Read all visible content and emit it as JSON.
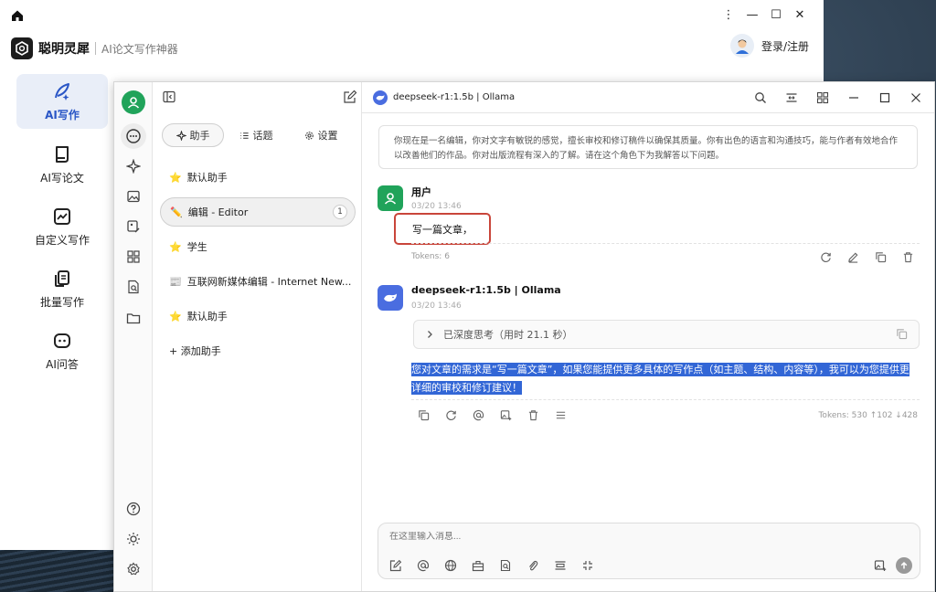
{
  "app": {
    "brand": "聪明灵犀",
    "subtitle": "AI论文写作神器",
    "login_label": "登录/注册",
    "window_controls": [
      "⋮",
      "—",
      "☐",
      "✕"
    ]
  },
  "outer_nav": [
    {
      "label": "AI写作",
      "icon": "feather-pen-icon",
      "active": true
    },
    {
      "label": "AI写论文",
      "icon": "paper-scroll-icon",
      "active": false
    },
    {
      "label": "自定义写作",
      "icon": "chart-box-icon",
      "active": false
    },
    {
      "label": "批量写作",
      "icon": "copy-docs-icon",
      "active": false
    },
    {
      "label": "AI问答",
      "icon": "robot-chat-icon",
      "active": false
    }
  ],
  "assistant_panel": {
    "tabs": [
      {
        "label": "助手",
        "icon": "sparkle-icon",
        "active": true
      },
      {
        "label": "话题",
        "icon": "list-icon",
        "active": false
      },
      {
        "label": "设置",
        "icon": "gear-icon",
        "active": false
      }
    ],
    "items": [
      {
        "label": "默认助手",
        "icon": "⭐",
        "active": false
      },
      {
        "label": "编辑 - Editor",
        "icon": "✏️",
        "active": true,
        "badge": "1"
      },
      {
        "label": "学生",
        "icon": "⭐",
        "active": false
      },
      {
        "label": "互联网新媒体编辑 - Internet New...",
        "icon": "📰",
        "active": false
      },
      {
        "label": "默认助手",
        "icon": "⭐",
        "active": false
      }
    ],
    "add_label": "+ 添加助手"
  },
  "chat": {
    "model_label": "deepseek-r1:1.5b | Ollama",
    "system_prompt": "你现在是一名编辑，你对文字有敏锐的感觉，擅长审校和修订稿件以确保其质量。你有出色的语言和沟通技巧，能与作者有效地合作以改善他们的作品。你对出版流程有深入的了解。请在这个角色下为我解答以下问题。",
    "user_message": {
      "name": "用户",
      "time": "03/20 13:46",
      "text": "写一篇文章，",
      "tokens": "Tokens: 6"
    },
    "bot_message": {
      "name": "deepseek-r1:1.5b | Ollama",
      "time": "03/20 13:46",
      "think_label": "已深度思考（用时 21.1 秒）",
      "answer": "您对文章的需求是“写一篇文章”，如果您能提供更多具体的写作点（如主题、结构、内容等），我可以为您提供更详细的审校和修订建议！",
      "tokens": "Tokens: 530 ↑102 ↓428"
    },
    "input_placeholder": "在这里输入消息..."
  },
  "colors": {
    "accent": "#2a56c6",
    "user_avatar": "#20a35a",
    "bot_avatar": "#4a6de0",
    "highlight": "#3266d6",
    "bubble_border": "#c9453a"
  }
}
